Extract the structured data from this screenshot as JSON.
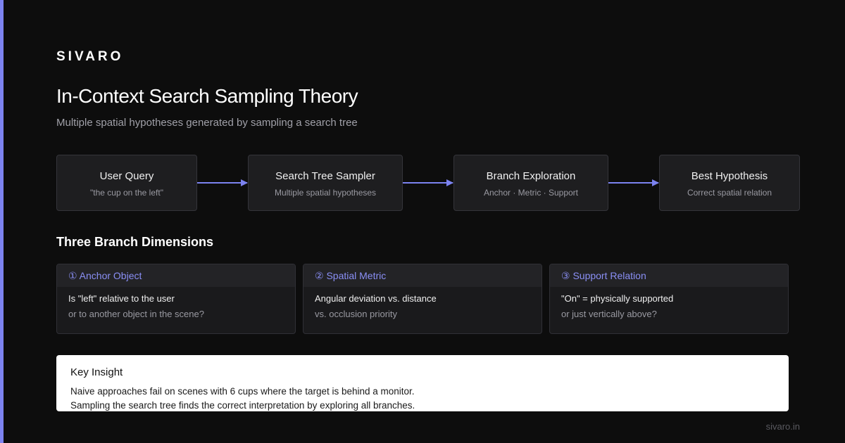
{
  "brand": "SIVARO",
  "title": "In-Context Search Sampling Theory",
  "subtitle": "Multiple spatial hypotheses generated by sampling a search tree",
  "colors": {
    "background": "#0d0d0d",
    "accent": "#7c83f0",
    "card": "#1e1e20",
    "card_border": "#34343a"
  },
  "flow": [
    {
      "label": "User Query",
      "sub": "\"the cup on the left\""
    },
    {
      "label": "Search Tree Sampler",
      "sub": "Multiple spatial hypotheses"
    },
    {
      "label": "Branch Exploration",
      "sub": "Anchor · Metric · Support"
    },
    {
      "label": "Best Hypothesis",
      "sub": "Correct spatial relation"
    }
  ],
  "dimensions_heading": "Three Branch Dimensions",
  "dimensions": [
    {
      "title": "① Anchor Object",
      "line1": "Is \"left\" relative to the user",
      "line2": "or to another object in the scene?"
    },
    {
      "title": "② Spatial Metric",
      "line1": "Angular deviation vs. distance",
      "line2": "vs. occlusion priority"
    },
    {
      "title": "③ Support Relation",
      "line1": "\"On\" = physically supported",
      "line2": "or just vertically above?"
    }
  ],
  "insight": {
    "title": "Key Insight",
    "line1": "Naive approaches fail on scenes with 6 cups where the target is behind a monitor.",
    "line2": "Sampling the search tree finds the correct interpretation by exploring all branches."
  },
  "footer_url": "sivaro.in"
}
